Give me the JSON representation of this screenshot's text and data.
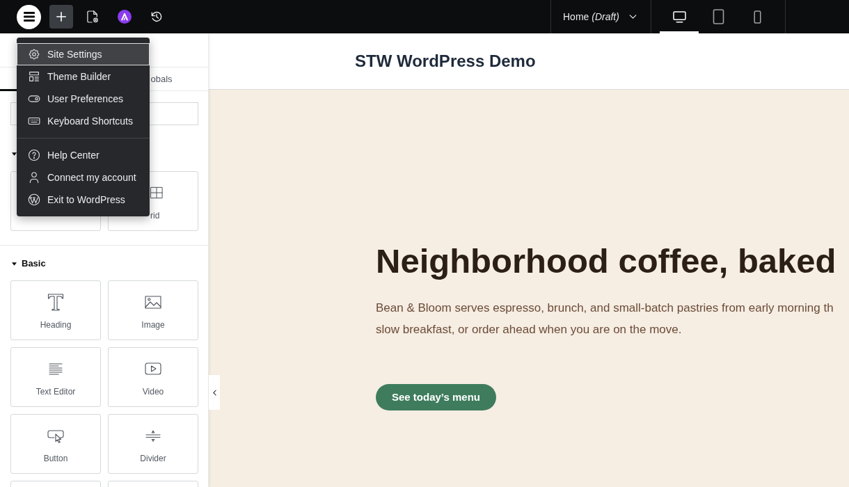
{
  "topbar": {
    "menu_button": {
      "expanded": true
    },
    "page": {
      "title": "Home *(Draft)*"
    },
    "devices": [
      {
        "kind": "desktop",
        "selected": true
      },
      {
        "kind": "tablet",
        "selected": false
      },
      {
        "kind": "mobile",
        "selected": false
      }
    ]
  },
  "main_menu": {
    "groups": [
      {
        "items": [
          {
            "kind": "settings",
            "label": "Site Settings",
            "selected": true
          },
          {
            "kind": "theme",
            "label": "Theme Builder",
            "selected": false
          },
          {
            "kind": "preferences",
            "label": "User Preferences",
            "selected": false
          },
          {
            "kind": "shortcuts",
            "label": "Keyboard Shortcuts",
            "selected": false
          }
        ]
      },
      {
        "items": [
          {
            "kind": "help",
            "label": "Help Center",
            "selected": false
          },
          {
            "kind": "account",
            "label": "Connect my account",
            "selected": false
          },
          {
            "kind": "exit",
            "label": "Exit to WordPress",
            "selected": false
          }
        ]
      }
    ]
  },
  "panel": {
    "tabs": [
      {
        "selected": true
      },
      {
        "label": "obals",
        "selected": false
      }
    ],
    "sections": [
      {
        "expanded": true,
        "widgets": [
          {
            "kind": "container"
          },
          {
            "kind": "grid",
            "label": "rid"
          }
        ]
      },
      {
        "title": "Basic",
        "expanded": true,
        "widgets": [
          {
            "kind": "heading",
            "label": "Heading"
          },
          {
            "kind": "image",
            "label": "Image"
          },
          {
            "kind": "text",
            "label": "Text Editor"
          },
          {
            "kind": "video",
            "label": "Video"
          },
          {
            "kind": "button",
            "label": "Button"
          },
          {
            "kind": "divider",
            "label": "Divider"
          },
          {
            "kind": "cut_off"
          },
          {
            "kind": "cut_off"
          }
        ]
      }
    ]
  },
  "canvas": {
    "site_title": "STW WordPress Demo",
    "hero": {
      "heading": "Neighborhood coffee, baked",
      "paragraph_lines": [
        "Bean & Bloom serves espresso, brunch, and small-batch pastries from early morning th",
        "slow breakfast, or order ahead when you are on the move."
      ],
      "button": "See today’s menu"
    }
  }
}
